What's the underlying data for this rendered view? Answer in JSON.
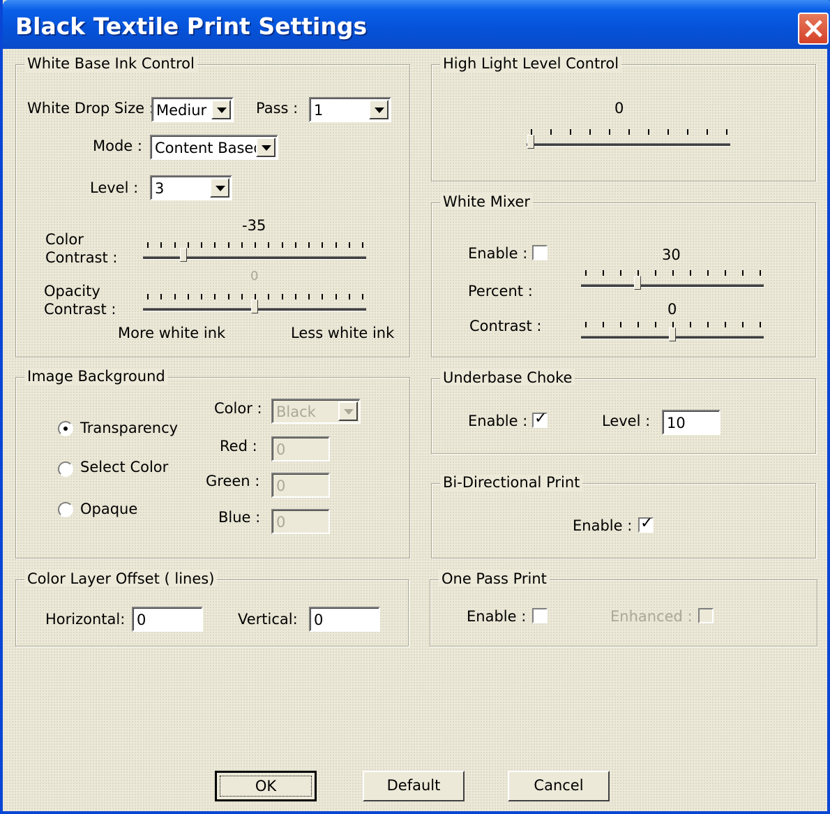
{
  "window": {
    "title": "Black Textile Print Settings"
  },
  "white_base": {
    "legend": "White Base Ink Control",
    "drop_size_label": "White Drop Size :",
    "drop_size_value": "Mediur",
    "pass_label": "Pass :",
    "pass_value": "1",
    "mode_label": "Mode :",
    "mode_value": "Content Based",
    "level_label": "Level :",
    "level_value": "3",
    "color_contrast_label_1": "Color",
    "color_contrast_label_2": "Contrast :",
    "color_contrast_value": "-35",
    "color_contrast_fraction": 0.17,
    "opacity_contrast_label_1": "Opacity",
    "opacity_contrast_label_2": "Contrast :",
    "opacity_contrast_value": "0",
    "opacity_contrast_fraction": 0.5,
    "more_ink_label": "More white ink",
    "less_ink_label": "Less white ink"
  },
  "highlight": {
    "legend": "High Light Level Control",
    "value": "0",
    "fraction": 0.0
  },
  "white_mixer": {
    "legend": "White Mixer",
    "enable_label": "Enable :",
    "enabled": false,
    "percent_label": "Percent :",
    "percent_value": "30",
    "percent_fraction": 0.3,
    "contrast_label": "Contrast :",
    "contrast_value": "0",
    "contrast_fraction": 0.5
  },
  "image_background": {
    "legend": "Image Background",
    "transparency_label": "Transparency",
    "select_color_label": "Select Color",
    "opaque_label": "Opaque",
    "selected": "transparency",
    "color_label": "Color :",
    "color_value": "Black",
    "red_label": "Red :",
    "red_value": "0",
    "green_label": "Green :",
    "green_value": "0",
    "blue_label": "Blue :",
    "blue_value": "0"
  },
  "underbase_choke": {
    "legend": "Underbase Choke",
    "enable_label": "Enable :",
    "enabled": true,
    "level_label": "Level :",
    "level_value": "10"
  },
  "bidirectional": {
    "legend": "Bi-Directional Print",
    "enable_label": "Enable :",
    "enabled": true
  },
  "color_layer_offset": {
    "legend": "Color Layer Offset ( lines)",
    "horizontal_label": "Horizontal:",
    "horizontal_value": "0",
    "vertical_label": "Vertical:",
    "vertical_value": "0"
  },
  "one_pass": {
    "legend": "One Pass Print",
    "enable_label": "Enable :",
    "enabled": false,
    "enhanced_label": "Enhanced :",
    "enhanced": false
  },
  "buttons": {
    "ok": "OK",
    "default": "Default",
    "cancel": "Cancel"
  }
}
